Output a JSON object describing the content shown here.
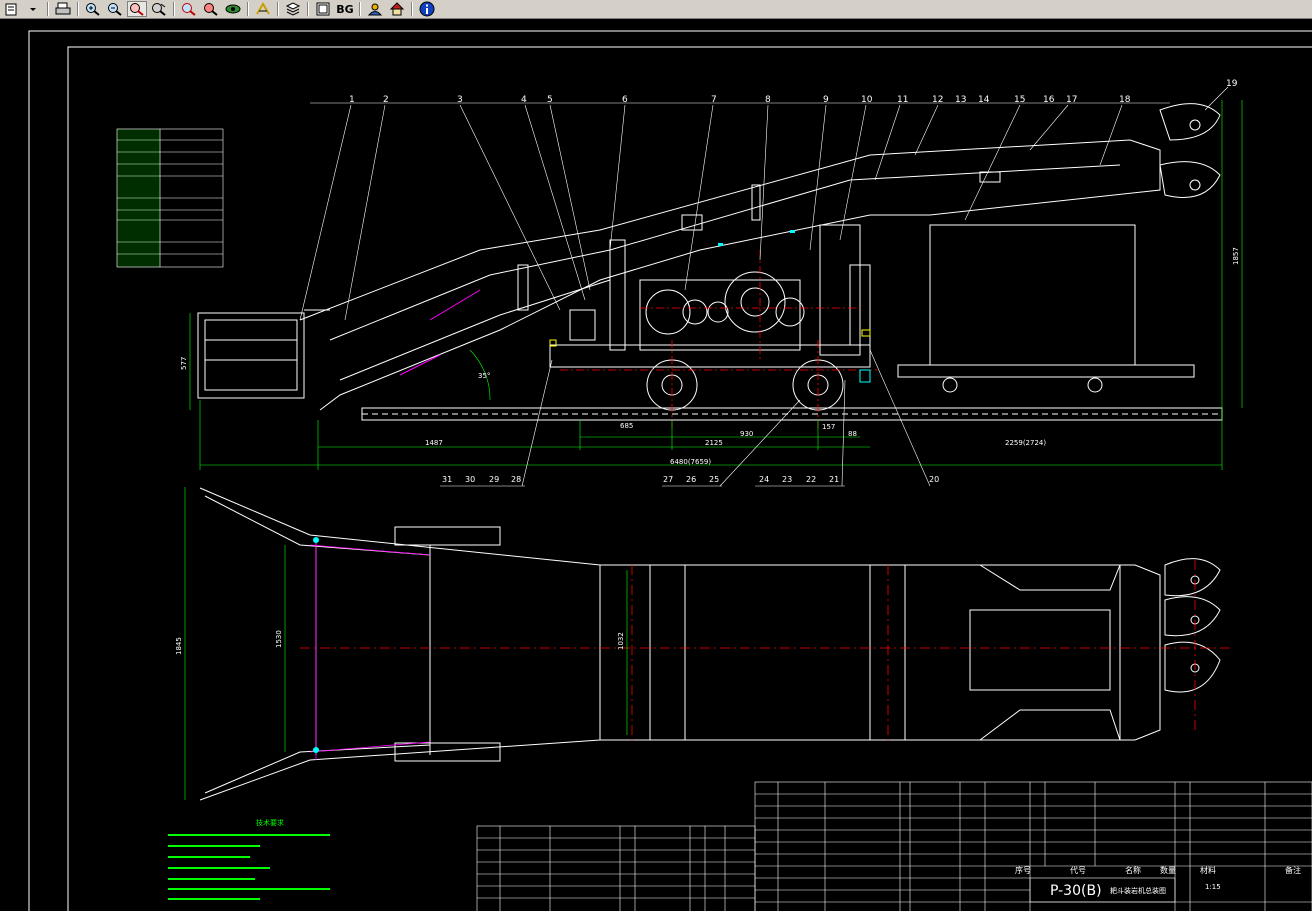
{
  "toolbar": {
    "buttons": [
      {
        "name": "open-file-icon"
      },
      {
        "name": "dropdown-arrow-icon"
      },
      {
        "name": "print-icon"
      },
      {
        "name": "zoom-in-icon"
      },
      {
        "name": "zoom-out-icon"
      },
      {
        "name": "zoom-window-icon"
      },
      {
        "name": "pan-icon"
      },
      {
        "name": "zoom-extents-icon"
      },
      {
        "name": "zoom-previous-icon"
      },
      {
        "name": "rotate-view-icon"
      },
      {
        "name": "measure-icon"
      },
      {
        "name": "layers-icon"
      },
      {
        "name": "model-icon"
      },
      {
        "name": "help-user-icon"
      },
      {
        "name": "home-icon"
      },
      {
        "name": "info-icon"
      }
    ],
    "bg_label": "BG"
  },
  "drawing": {
    "colors": {
      "background": "#000000",
      "lines": "#ffffff",
      "dimensions": "#00ff00",
      "centerlines": "#ff0000",
      "hidden": "#ff00ff",
      "accent": "#00ffff",
      "highlight": "#ffff00"
    },
    "balloons_top": [
      "1",
      "2",
      "3",
      "4",
      "5",
      "6",
      "7",
      "8",
      "9",
      "10",
      "11",
      "12",
      "13",
      "14",
      "15",
      "16",
      "17",
      "18"
    ],
    "balloon_19": "19",
    "balloons_bottom_a": [
      "31",
      "30",
      "29",
      "28"
    ],
    "balloons_bottom_b": [
      "27",
      "26",
      "25"
    ],
    "balloons_bottom_c": [
      "24",
      "23",
      "22",
      "21"
    ],
    "balloon_20": "20",
    "dimensions": {
      "d1487": "1487",
      "d685": "685",
      "d2125": "2125",
      "d930": "930",
      "d157": "157",
      "d88": "88",
      "overall": "6480(7659)",
      "right": "2259(2724)",
      "height_left": "577",
      "height_right": "1857",
      "angle": "35°",
      "plan_width": "1845",
      "plan_inner": "1530",
      "plan_mid": "1032"
    },
    "title_block": {
      "model": "P-30(B)",
      "subtitle": "耙斗装岩机总装图",
      "scale": "1:15",
      "cols": [
        "序号",
        "代号",
        "名称",
        "数量",
        "材料",
        "备注"
      ]
    },
    "notes_title": "技术要求"
  }
}
